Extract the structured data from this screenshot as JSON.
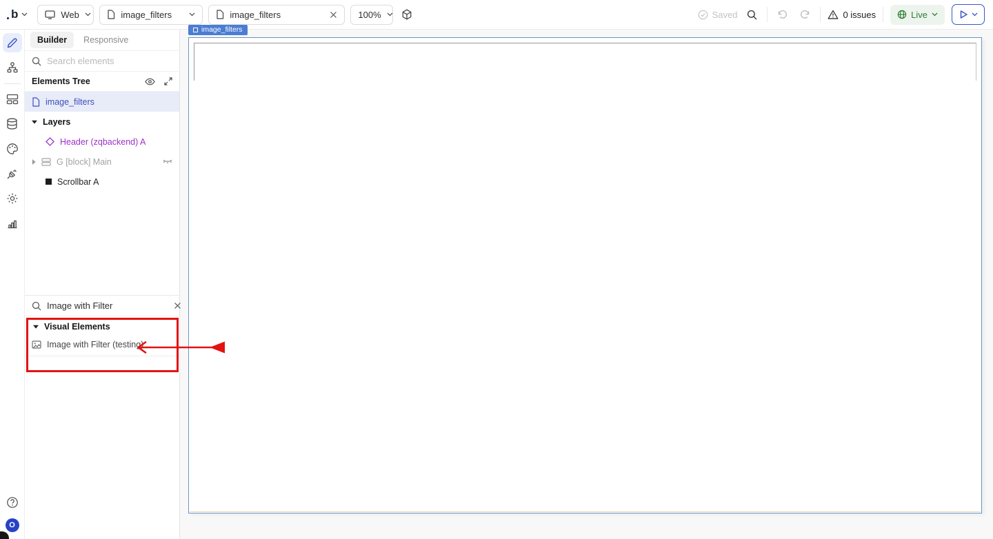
{
  "toolbar": {
    "logo_letter": "b",
    "device_label": "Web",
    "page_selector_label": "image_filters",
    "tab_label": "image_filters",
    "zoom_level": "100%",
    "saved_label": "Saved",
    "issues_label": "0 issues",
    "live_label": "Live"
  },
  "rail": {
    "items": [
      {
        "name": "design",
        "icon": "pencil-icon",
        "active": true
      },
      {
        "name": "workflow",
        "icon": "workflow-icon",
        "active": false
      },
      {
        "name": "reusables",
        "icon": "components-icon",
        "active": false
      },
      {
        "name": "data",
        "icon": "database-icon",
        "active": false
      },
      {
        "name": "styles",
        "icon": "palette-icon",
        "active": false
      },
      {
        "name": "plugins",
        "icon": "plug-icon",
        "active": false
      },
      {
        "name": "settings",
        "icon": "gear-icon",
        "active": false
      },
      {
        "name": "logs",
        "icon": "chart-icon",
        "active": false
      }
    ],
    "user_badge": "O"
  },
  "panel": {
    "tabs": [
      {
        "label": "Builder",
        "active": true
      },
      {
        "label": "Responsive",
        "active": false
      }
    ],
    "search_placeholder": "Search elements",
    "tree_header": "Elements Tree",
    "tree_items": [
      {
        "label": "image_filters",
        "type": "page",
        "selected": true
      },
      {
        "label": "Layers",
        "type": "section"
      },
      {
        "label": "Header (zqbackend) A",
        "type": "reusable"
      },
      {
        "label": "G [block] Main",
        "type": "group",
        "hidden": true
      },
      {
        "label": "Scrollbar A",
        "type": "element"
      }
    ],
    "insert_search_value": "Image with Filter",
    "results_section_label": "Visual Elements",
    "result_item_label": "Image with Filter (testing)"
  },
  "canvas": {
    "page_label": "image_filters"
  },
  "colors": {
    "accent_blue": "#3b55c8",
    "selection_bg": "#e8ecf9",
    "selection_text": "#3d4eb8",
    "reusable_purple": "#9b30c8",
    "annotation_red": "#e31212",
    "canvas_label_blue": "#4a7dd3",
    "canvas_border_blue": "#6e94c5",
    "live_green": "#2e7d32"
  }
}
